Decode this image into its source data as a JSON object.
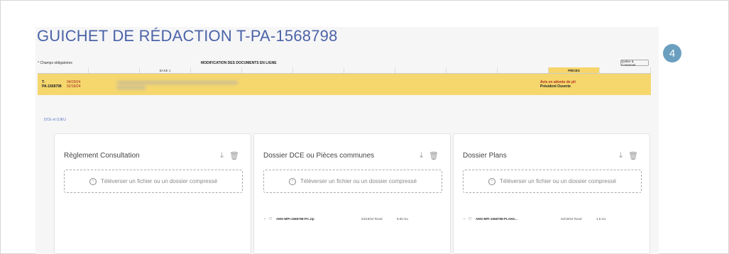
{
  "page": {
    "title": "GUICHET DE RÉDACTION T-PA-1568798",
    "badge": "4"
  },
  "toolbar": {
    "required_note": "* Champs obligatoires",
    "section_title": "MODIFICATION DES DOCUMENTS EN LIGNE",
    "save_label": "Quitter & Conserver"
  },
  "tabs": [
    {
      "label": "",
      "style": "dim"
    },
    {
      "label": "",
      "style": "dim"
    },
    {
      "label": "BASE 1",
      "style": "dark"
    },
    {
      "label": "",
      "style": "dim"
    },
    {
      "label": "",
      "style": "dim"
    },
    {
      "label": "",
      "style": "dim"
    },
    {
      "label": "",
      "style": "dim"
    },
    {
      "label": "",
      "style": "dim"
    },
    {
      "label": "",
      "style": "dim"
    },
    {
      "label": "",
      "style": "dim"
    },
    {
      "label": "PIÈCES",
      "style": "active"
    },
    {
      "label": "",
      "style": "dim"
    }
  ],
  "info": {
    "ref_line1": "T-",
    "ref_line2": "PA-1568798",
    "date1": "04/29/24",
    "date2": "02/18/24",
    "status_line1": "Avis en attente de pli",
    "status_line2": "Président Ouverte"
  },
  "sub_link": "DCE et OJEU",
  "cards": [
    {
      "title": "Règlement Consultation",
      "upload_text": "Téléverser un fichier ou un dossier compressé",
      "file": null
    },
    {
      "title": "Dossier DCE ou Pièces communes",
      "upload_text": "Téléverser un fichier ou un dossier compressé",
      "file": {
        "name": "AMS-MPI-1568798-PC.zip",
        "date": "04/19/24 Rural",
        "size": "9.65 Go"
      }
    },
    {
      "title": "Dossier Plans",
      "upload_text": "Téléverser un fichier ou un dossier compressé",
      "file": {
        "name": "AMS-MPI-1568798-PLANS...",
        "date": "04/19/24 Rural",
        "size": "1.6 Go"
      }
    }
  ],
  "colors": {
    "title_blue": "#4b63a8",
    "band_yellow": "#f5d76e",
    "badge_teal": "#6b9fbf",
    "status_red": "#b2311f"
  }
}
